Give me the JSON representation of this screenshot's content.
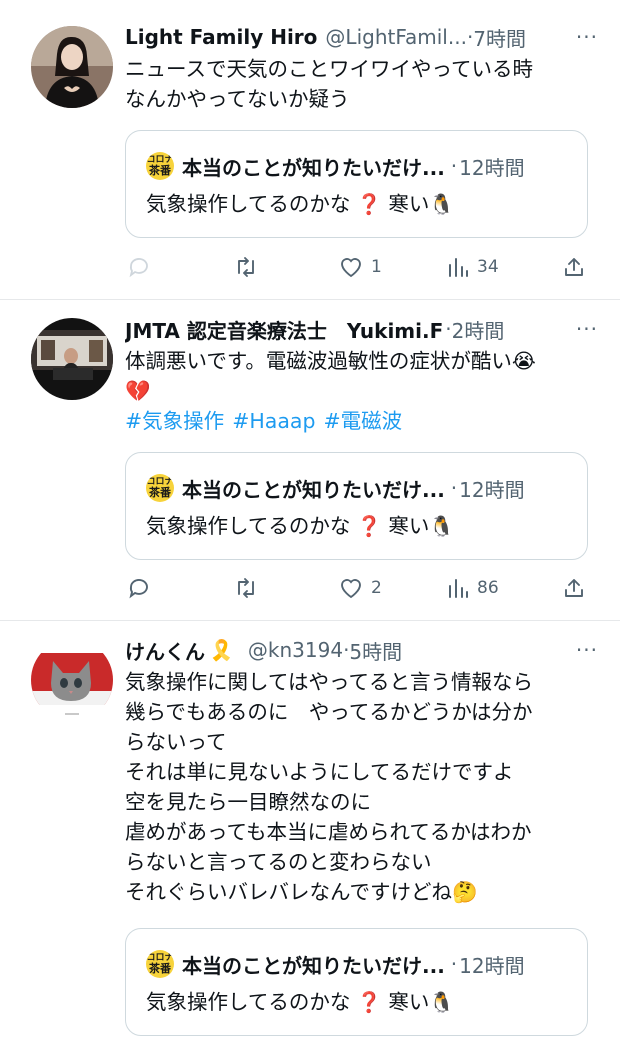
{
  "tweets": [
    {
      "name": "Light Family Hiro",
      "handle": "@LightFamil...",
      "dot": "·",
      "time": "7時間",
      "more": "···",
      "text": "ニュースで天気のことワイワイやっている時\nなんかやってないか疑う",
      "hashtags": [],
      "quote": {
        "logo_top": "コロナ",
        "logo_bottom": "茶番",
        "name": "本当のことが知りたいだけ...",
        "dot": "·",
        "time": "12時間",
        "text": "気象操作してるのかな",
        "emoji1": "❓",
        "text2": "寒い",
        "emoji2": "🐧"
      },
      "reply_count": "",
      "retweet_count": "",
      "like_count": "1",
      "view_count": "34"
    },
    {
      "name": "JMTA 認定音楽療法士　Yukimi.F",
      "handle": "",
      "dot": "·",
      "time": "2時間",
      "more": "···",
      "text": "体調悪いです。電磁波過敏性の症状が酷い😭\n💔",
      "hashtags": [
        "#気象操作",
        "#Haaap",
        "#電磁波"
      ],
      "quote": {
        "logo_top": "コロナ",
        "logo_bottom": "茶番",
        "name": "本当のことが知りたいだけ...",
        "dot": "·",
        "time": "12時間",
        "text": "気象操作してるのかな",
        "emoji1": "❓",
        "text2": "寒い",
        "emoji2": "🐧"
      },
      "reply_count": "",
      "retweet_count": "",
      "like_count": "2",
      "view_count": "86"
    },
    {
      "name": "けんくん",
      "name_emoji": "🎗️",
      "handle": "@kn3194",
      "dot": "·",
      "time": "5時間",
      "more": "···",
      "text": "気象操作に関してはやってると言う情報なら\n幾らでもあるのに　やってるかどうかは分か\nらないって\nそれは単に見ないようにしてるだけですよ\n空を見たら一目瞭然なのに\n虐めがあっても本当に虐められてるかはわか\nらないと言ってるのと変わらない\nそれぐらいバレバレなんですけどね🤔",
      "hashtags": [],
      "quote": {
        "logo_top": "コロナ",
        "logo_bottom": "茶番",
        "name": "本当のことが知りたいだけ...",
        "dot": "·",
        "time": "12時間",
        "text": "気象操作してるのかな",
        "emoji1": "❓",
        "text2": "寒い",
        "emoji2": "🐧"
      }
    }
  ],
  "colors": {
    "text": "#0f1419",
    "muted": "#536471",
    "link": "#1d9bf0",
    "border": "#cfd9de",
    "logo": "#f7d33b"
  },
  "icons": {
    "reply": "reply-icon",
    "retweet": "retweet-icon",
    "like": "heart-icon",
    "views": "views-bar-icon",
    "share": "share-icon",
    "more": "more-dots-icon"
  }
}
